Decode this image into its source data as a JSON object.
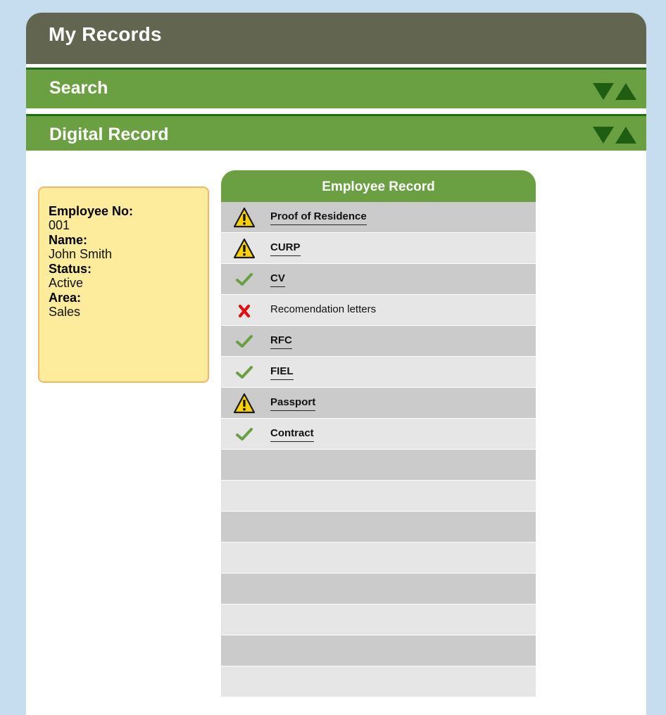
{
  "header": {
    "title": "My Records"
  },
  "sections": {
    "search_label": "Search",
    "digital_record_label": "Digital Record"
  },
  "employee": {
    "no_label": "Employee No:",
    "no_value": "001",
    "name_label": "Name:",
    "name_value": "John Smith",
    "status_label": "Status:",
    "status_value": "Active",
    "area_label": "Area:",
    "area_value": "Sales"
  },
  "record": {
    "title": "Employee Record",
    "items": [
      {
        "label": "Proof of Residence",
        "status": "warning",
        "icon": "warning-icon",
        "linked": true
      },
      {
        "label": "CURP",
        "status": "warning",
        "icon": "warning-icon",
        "linked": true
      },
      {
        "label": "CV",
        "status": "ok",
        "icon": "check-icon",
        "linked": true
      },
      {
        "label": "Recomendation letters",
        "status": "missing",
        "icon": "x-icon",
        "linked": false
      },
      {
        "label": "RFC",
        "status": "ok",
        "icon": "check-icon",
        "linked": true
      },
      {
        "label": "FIEL",
        "status": "ok",
        "icon": "check-icon",
        "linked": true
      },
      {
        "label": "Passport",
        "status": "warning",
        "icon": "warning-icon",
        "linked": true
      },
      {
        "label": "Contract",
        "status": "ok",
        "icon": "check-icon",
        "linked": true
      }
    ],
    "empty_rows": 8
  },
  "colors": {
    "background": "#c6dcef",
    "title_bar": "#626650",
    "section_green": "#6ba042",
    "toggle_green": "#1f5e12",
    "card_yellow": "#fcec9c",
    "card_border": "#f2b86a",
    "row_dark": "#cbcbcb",
    "row_light": "#e6e6e6"
  }
}
